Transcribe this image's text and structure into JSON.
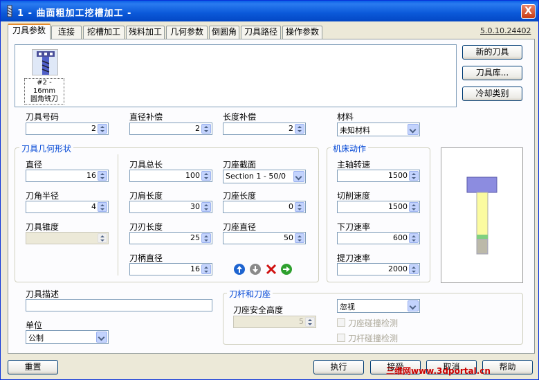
{
  "window": {
    "title": "1 - 曲面粗加工挖槽加工 -",
    "close_label": "X"
  },
  "tabs": [
    {
      "label": "刀具参数",
      "active": true
    },
    {
      "label": "连接"
    },
    {
      "label": "挖槽加工"
    },
    {
      "label": "残料加工"
    },
    {
      "label": "几何参数"
    },
    {
      "label": "倒圆角"
    },
    {
      "label": "刀具路径"
    },
    {
      "label": "操作参数"
    }
  ],
  "version": "5.0.10.24402",
  "tool": {
    "label_line1": "#2 - 16mm",
    "label_line2": "圆角铣刀"
  },
  "side_buttons": {
    "new_tool": "新的刀具",
    "tool_library": "刀具库...",
    "coolant": "冷却类别"
  },
  "fields": {
    "tool_number": {
      "label": "刀具号码",
      "value": "2"
    },
    "dia_offset": {
      "label": "直径补偿",
      "value": "2"
    },
    "len_offset": {
      "label": "长度补偿",
      "value": "2"
    },
    "material": {
      "label": "材料",
      "value": "未知材料"
    }
  },
  "geometry": {
    "title": "刀具几何形状",
    "diameter": {
      "label": "直径",
      "value": "16"
    },
    "corner_radius": {
      "label": "刀角半径",
      "value": "4"
    },
    "taper": {
      "label": "刀具锥度",
      "value": ""
    },
    "overall_length": {
      "label": "刀具总长",
      "value": "100"
    },
    "shoulder_length": {
      "label": "刀肩长度",
      "value": "30"
    },
    "flute_length": {
      "label": "刀刃长度",
      "value": "25"
    },
    "shank_diameter": {
      "label": "刀柄直径",
      "value": "16"
    },
    "holder_section": {
      "label": "刀座截面",
      "value": "Section 1 - 50/0"
    },
    "holder_length": {
      "label": "刀座长度",
      "value": "0"
    },
    "holder_diameter": {
      "label": "刀座直径",
      "value": "50"
    }
  },
  "machine": {
    "title": "机床动作",
    "spindle": {
      "label": "主轴转速",
      "value": "1500"
    },
    "feed": {
      "label": "切削速度",
      "value": "1500"
    },
    "plunge": {
      "label": "下刀速率",
      "value": "600"
    },
    "retract": {
      "label": "提刀速率",
      "value": "2000"
    }
  },
  "description": {
    "label": "刀具描述",
    "value": ""
  },
  "units": {
    "label": "单位",
    "value": "公制"
  },
  "holder": {
    "title": "刀杆和刀座",
    "mode": "忽视",
    "safety_label": "刀座安全高度",
    "safety_value": "5",
    "check1": "刀座碰撞检测",
    "check2": "刀杆碰撞检测"
  },
  "footer": {
    "reset": "重置",
    "execute": "执行",
    "accept": "接受",
    "cancel": "取消",
    "help": "帮助"
  },
  "watermark": "三维网www.3dportal.cn",
  "colors": {
    "accent_tab": "#e68b2c",
    "group_title": "#0046d5",
    "title_bar": "#0b59d9"
  }
}
